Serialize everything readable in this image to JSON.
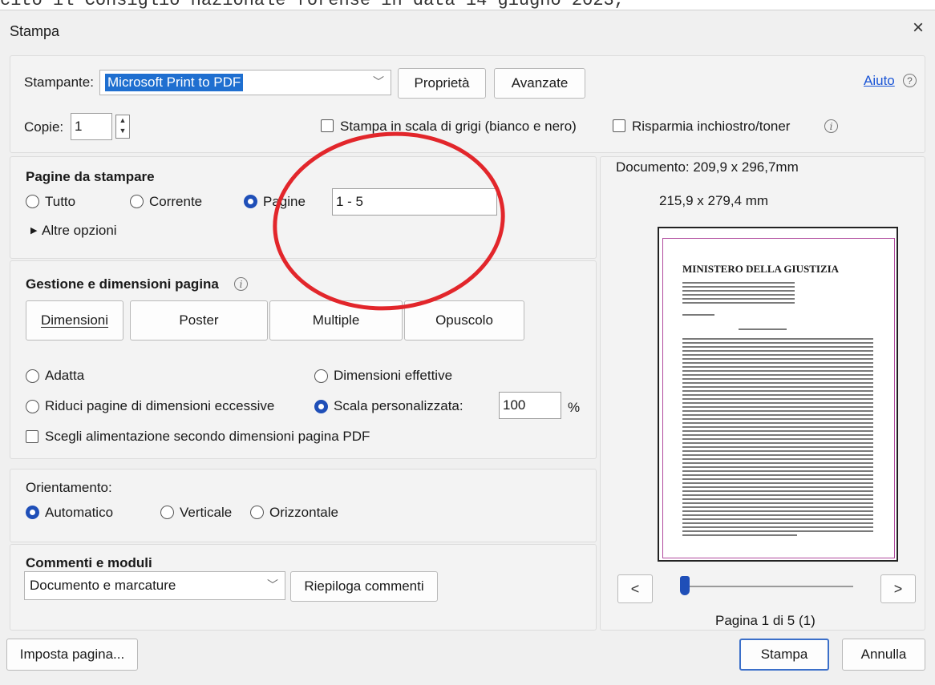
{
  "background_text": "cito il Consiglio nazionale forense in data 14 giugno 2023,",
  "dialog": {
    "title": "Stampa",
    "close": "×"
  },
  "top": {
    "printer_label": "Stampante:",
    "printer_value": "Microsoft Print to PDF",
    "properties_btn": "Proprietà",
    "advanced_btn": "Avanzate",
    "help_link": "Aiuto",
    "help_icon": "?",
    "copies_label": "Copie:",
    "copies_value": "1",
    "grayscale_label": "Stampa in scala di grigi (bianco e nero)",
    "save_ink_label": "Risparmia inchiostro/toner",
    "info_icon": "i"
  },
  "pages": {
    "heading": "Pagine da stampare",
    "all": "Tutto",
    "current": "Corrente",
    "pages": "Pagine",
    "range_value": "1 - 5",
    "more_options": "Altre opzioni",
    "triangle": "▶"
  },
  "sizing": {
    "heading": "Gestione e dimensioni pagina",
    "info_icon": "i",
    "btn_size": "Dimensioni",
    "btn_poster": "Poster",
    "btn_multiple": "Multiple",
    "btn_booklet": "Opuscolo",
    "fit": "Adatta",
    "actual": "Dimensioni effettive",
    "shrink": "Riduci pagine di dimensioni eccessive",
    "custom_scale": "Scala personalizzata:",
    "scale_value": "100",
    "percent": "%",
    "paper_source": "Scegli alimentazione secondo dimensioni pagina PDF"
  },
  "orientation": {
    "heading": "Orientamento:",
    "auto": "Automatico",
    "portrait": "Verticale",
    "landscape": "Orizzontale"
  },
  "comments": {
    "heading": "Commenti e moduli",
    "value": "Documento e marcature",
    "summarize_btn": "Riepiloga commenti"
  },
  "preview": {
    "document_size": "Documento: 209,9 x 296,7mm",
    "paper_size": "215,9 x 279,4 mm",
    "doc_title": "MINISTERO DELLA GIUSTIZIA",
    "prev": "<",
    "next": ">",
    "page_info": "Pagina 1 di 5 (1)"
  },
  "bottom": {
    "page_setup_btn": "Imposta pagina...",
    "print_btn": "Stampa",
    "cancel_btn": "Annulla"
  },
  "colors": {
    "accent": "#1f4fb8",
    "annotation": "#e2262b",
    "link": "#1a55d6"
  }
}
